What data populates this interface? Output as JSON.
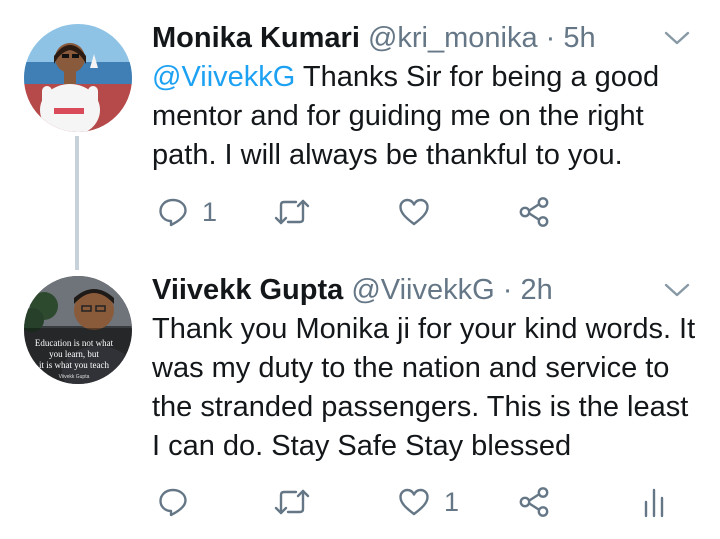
{
  "colors": {
    "accent": "#1da1f2",
    "text": "#14171a",
    "secondary": "#657786",
    "thread_line": "#c7d1d9"
  },
  "tweets": [
    {
      "display_name": "Monika Kumari",
      "handle": "@kri_monika",
      "separator": "·",
      "time": "5h",
      "mention": "@ViivekkG",
      "text": " Thanks Sir for being a good mentor and for guiding me on the right path. I will always be thankful to you.",
      "reply_count": "1",
      "retweet_count": "",
      "like_count": "",
      "icons": [
        "reply-icon",
        "retweet-icon",
        "like-icon",
        "share-icon"
      ]
    },
    {
      "display_name": "Viivekk Gupta",
      "handle": "@ViivekkG",
      "separator": "·",
      "time": "2h",
      "text": "Thank you Monika ji for your kind words. It was my duty to the nation and service to the stranded passengers. This is the least I can do. Stay Safe Stay blessed",
      "reply_count": "",
      "retweet_count": "",
      "like_count": "1",
      "avatar_caption": [
        "Education is not what",
        "you learn, but",
        "it is what you teach",
        "Viivekk Gupta"
      ],
      "icons": [
        "reply-icon",
        "retweet-icon",
        "like-icon",
        "share-icon",
        "analytics-icon"
      ]
    }
  ]
}
